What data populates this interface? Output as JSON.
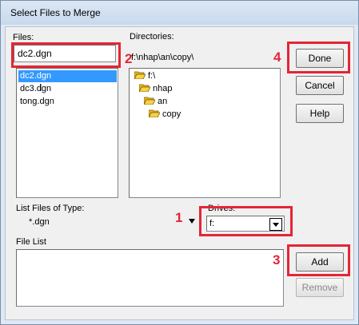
{
  "window": {
    "title": "Select Files to Merge"
  },
  "files": {
    "label": "Files:",
    "input_value": "dc2.dgn",
    "items": [
      {
        "label": "dc2.dgn",
        "selected": true
      },
      {
        "label": "dc3.dgn",
        "selected": false
      },
      {
        "label": "tong.dgn",
        "selected": false
      }
    ]
  },
  "directories": {
    "label": "Directories:",
    "path": "f:\\nhap\\an\\copy\\",
    "tree": [
      {
        "label": "f:\\",
        "depth": 0
      },
      {
        "label": "nhap",
        "depth": 1
      },
      {
        "label": "an",
        "depth": 2
      },
      {
        "label": "copy",
        "depth": 3
      }
    ]
  },
  "buttons": {
    "done": "Done",
    "cancel": "Cancel",
    "help": "Help",
    "add": "Add",
    "remove": "Remove"
  },
  "list_type": {
    "label": "List Files of Type:",
    "value": "*.dgn"
  },
  "drives": {
    "label": "Drives:",
    "value": "f:"
  },
  "file_list": {
    "label": "File List"
  },
  "annotations": {
    "n1": "1",
    "n2": "2",
    "n3": "3",
    "n4": "4"
  },
  "colors": {
    "highlight": "#e32636",
    "selection": "#3399ff",
    "folder": "#e8b923"
  }
}
